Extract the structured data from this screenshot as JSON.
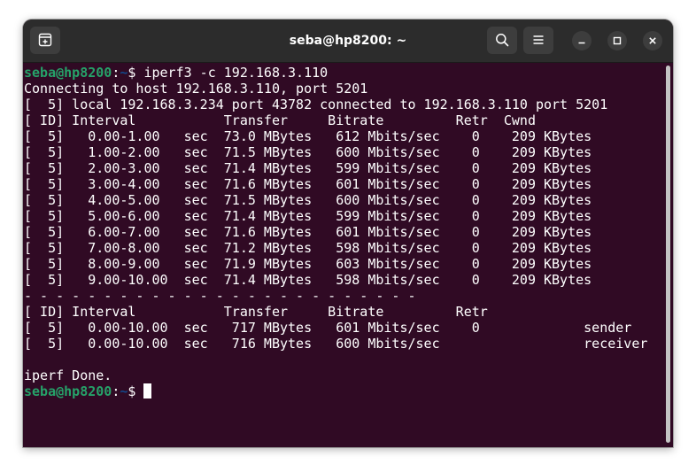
{
  "window": {
    "title": "seba@hp8200: ~"
  },
  "prompt": {
    "user_host": "seba@hp8200",
    "sep": ":",
    "path": "~",
    "symbol": "$ "
  },
  "command": "iperf3 -c 192.168.3.110",
  "output": [
    "Connecting to host 192.168.3.110, port 5201",
    "[  5] local 192.168.3.234 port 43782 connected to 192.168.3.110 port 5201",
    "[ ID] Interval           Transfer     Bitrate         Retr  Cwnd",
    "[  5]   0.00-1.00   sec  73.0 MBytes   612 Mbits/sec    0    209 KBytes",
    "[  5]   1.00-2.00   sec  71.5 MBytes   600 Mbits/sec    0    209 KBytes",
    "[  5]   2.00-3.00   sec  71.4 MBytes   599 Mbits/sec    0    209 KBytes",
    "[  5]   3.00-4.00   sec  71.6 MBytes   601 Mbits/sec    0    209 KBytes",
    "[  5]   4.00-5.00   sec  71.5 MBytes   600 Mbits/sec    0    209 KBytes",
    "[  5]   5.00-6.00   sec  71.4 MBytes   599 Mbits/sec    0    209 KBytes",
    "[  5]   6.00-7.00   sec  71.6 MBytes   601 Mbits/sec    0    209 KBytes",
    "[  5]   7.00-8.00   sec  71.2 MBytes   598 Mbits/sec    0    209 KBytes",
    "[  5]   8.00-9.00   sec  71.9 MBytes   603 Mbits/sec    0    209 KBytes",
    "[  5]   9.00-10.00  sec  71.4 MBytes   598 Mbits/sec    0    209 KBytes",
    "- - - - - - - - - - - - - - - - - - - - - - - - -",
    "[ ID] Interval           Transfer     Bitrate         Retr",
    "[  5]   0.00-10.00  sec   717 MBytes   601 Mbits/sec    0             sender",
    "[  5]   0.00-10.00  sec   716 MBytes   600 Mbits/sec                  receiver",
    "",
    "iperf Done."
  ],
  "colors": {
    "terminal_bg": "#300a24",
    "prompt_user": "#26a269",
    "prompt_path": "#12488b",
    "titlebar_bg": "#2c2c2c"
  },
  "icons": {
    "new_tab": "new-tab-icon",
    "search": "search-icon",
    "menu": "hamburger-menu-icon",
    "minimize": "minimize-icon",
    "maximize": "maximize-icon",
    "close": "close-icon"
  }
}
